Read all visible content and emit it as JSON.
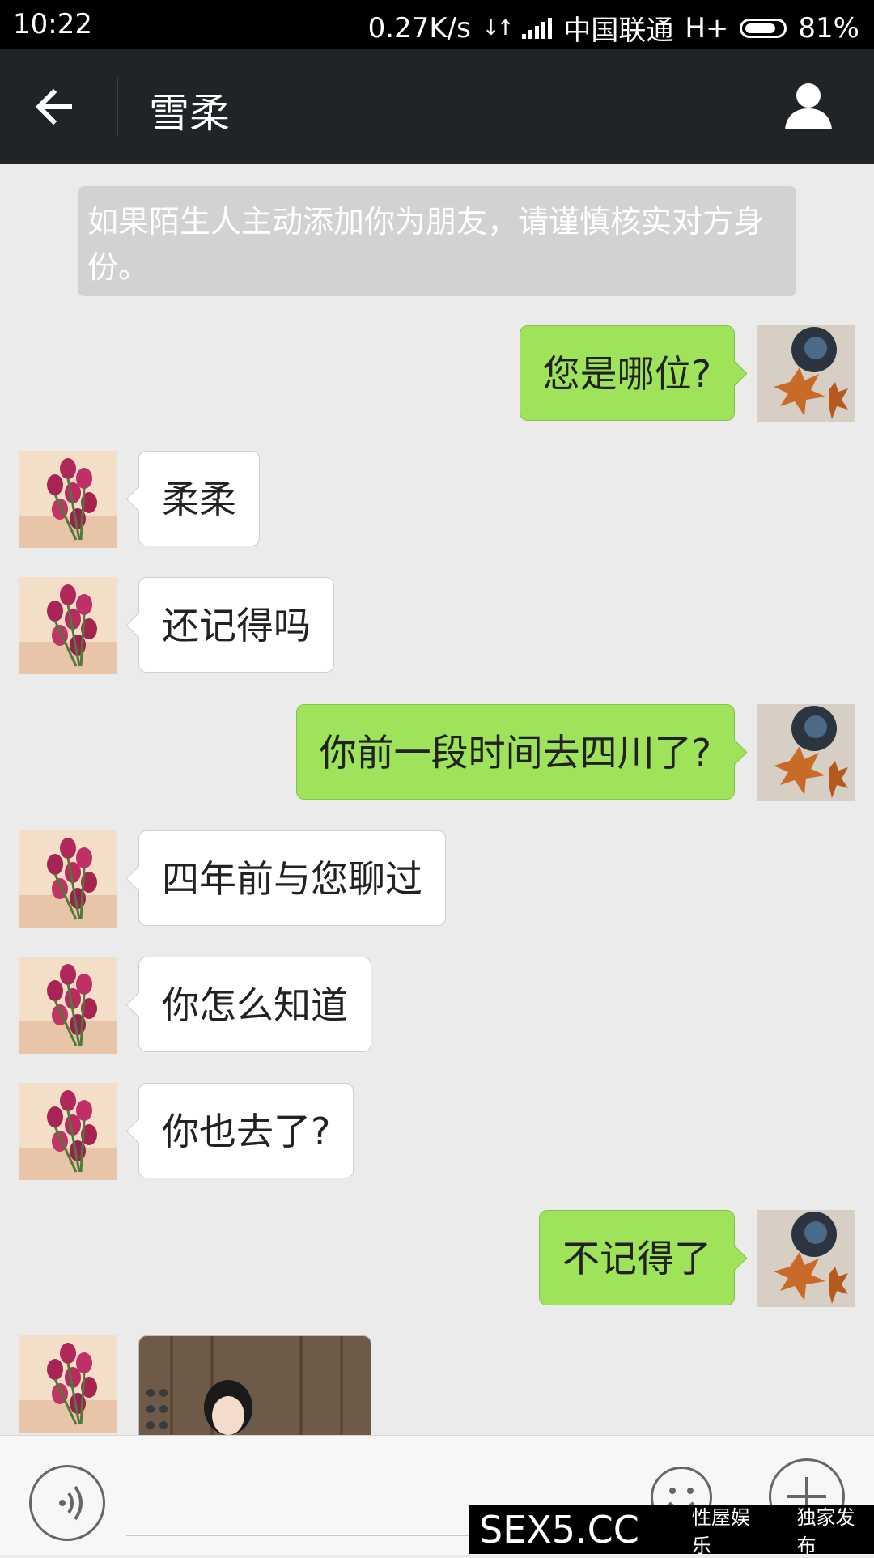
{
  "status_bar": {
    "time": "10:22",
    "speed": "0.27K/s",
    "carrier": "中国联通",
    "network": "H+",
    "battery_percent": "81%",
    "battery_level": 0.81
  },
  "header": {
    "title": "雪柔",
    "back_icon": "arrow-left-icon",
    "profile_icon": "person-icon",
    "background": "#1f2426"
  },
  "notice": "如果陌生人主动添加你为朋友，请谨慎核实对方身份。",
  "messages": [
    {
      "side": "out",
      "text": "您是哪位?"
    },
    {
      "side": "in",
      "text": "柔柔"
    },
    {
      "side": "in",
      "text": "还记得吗"
    },
    {
      "side": "out",
      "text": "你前一段时间去四川了?"
    },
    {
      "side": "in",
      "text": "四年前与您聊过"
    },
    {
      "side": "in",
      "text": "你怎么知道"
    },
    {
      "side": "in",
      "text": "你也去了?"
    },
    {
      "side": "out",
      "text": "不记得了"
    },
    {
      "side": "in",
      "type": "image"
    }
  ],
  "colors": {
    "outgoing_bubble": "#9fe35b",
    "incoming_bubble": "#ffffff",
    "chat_background": "#ebebeb"
  },
  "input_bar": {
    "voice_icon": "voice-wave-icon",
    "emoji_icon": "smiley-icon",
    "plus_icon": "plus-icon"
  },
  "watermark": {
    "main": "SEX5.CC",
    "left": "性屋娱乐",
    "right": "独家发布"
  }
}
